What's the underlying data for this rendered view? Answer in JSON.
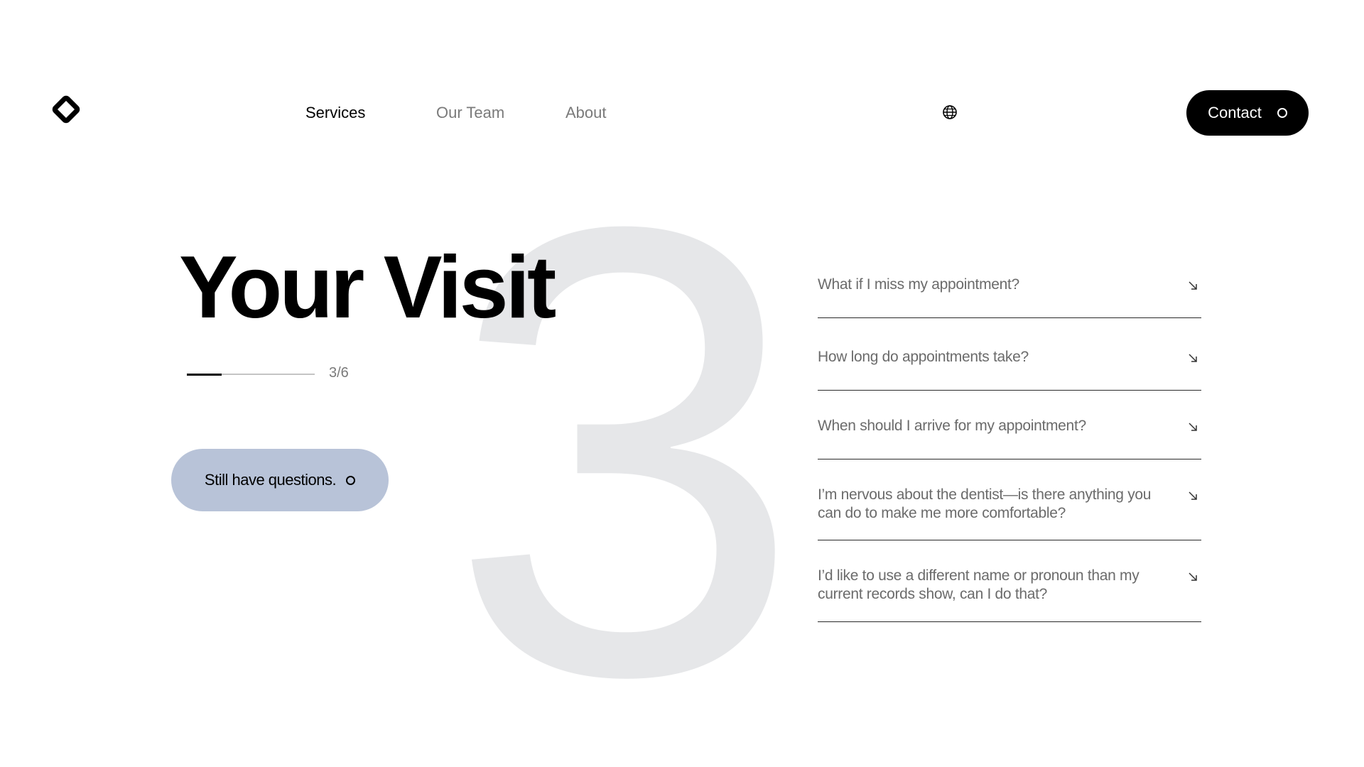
{
  "header": {
    "nav": [
      {
        "label": "Services",
        "active": true
      },
      {
        "label": "Our Team",
        "active": false
      },
      {
        "label": "About",
        "active": false
      }
    ],
    "language_icon": "globe-icon",
    "contact_label": "Contact",
    "logo_icon": "diamond-logo-icon"
  },
  "hero": {
    "big_number": "3",
    "title": "Your Visit",
    "progress": {
      "label": "3/6",
      "fraction": 0.27
    },
    "questions_button_label": "Still have questions."
  },
  "faq": {
    "items": [
      {
        "question": "What if I miss my appointment?",
        "icon": "arrow-down-right-icon"
      },
      {
        "question": "How long do appointments take?",
        "icon": "arrow-down-right-icon"
      },
      {
        "question": "When should I arrive for my appointment?",
        "icon": "arrow-down-right-icon"
      },
      {
        "question": "I’m nervous about the dentist—is there anything you can do to make me more comfortable?",
        "icon": "arrow-down-right-icon"
      },
      {
        "question": "I’d like to use a different name or pronoun than my current records show, can I do that?",
        "icon": "arrow-down-right-icon"
      }
    ]
  },
  "colors": {
    "accent_button": "#b8c3d8",
    "big_number": "#e6e7e9",
    "primary": "#000000"
  }
}
